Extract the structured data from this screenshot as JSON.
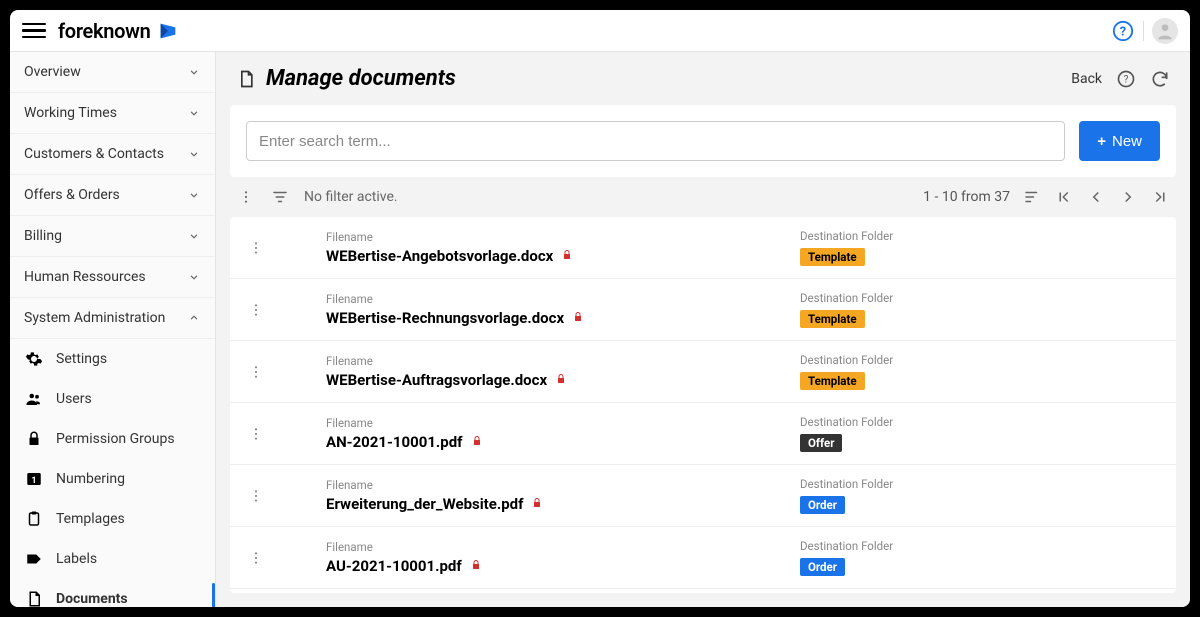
{
  "brand": "foreknown",
  "sidebar": {
    "groups": [
      {
        "label": "Overview",
        "expanded": false
      },
      {
        "label": "Working Times",
        "expanded": false
      },
      {
        "label": "Customers & Contacts",
        "expanded": false
      },
      {
        "label": "Offers & Orders",
        "expanded": false
      },
      {
        "label": "Billing",
        "expanded": false
      },
      {
        "label": "Human Ressources",
        "expanded": false
      },
      {
        "label": "System Administration",
        "expanded": true
      }
    ],
    "sysadmin_items": [
      {
        "icon": "gear",
        "label": "Settings"
      },
      {
        "icon": "users",
        "label": "Users"
      },
      {
        "icon": "lock",
        "label": "Permission Groups"
      },
      {
        "icon": "numbering",
        "label": "Numbering"
      },
      {
        "icon": "clipboard",
        "label": "Templages"
      },
      {
        "icon": "label",
        "label": "Labels"
      },
      {
        "icon": "document",
        "label": "Documents",
        "active": true
      }
    ]
  },
  "page": {
    "title": "Manage documents",
    "back": "Back",
    "search_placeholder": "Enter search term...",
    "new_button": "New",
    "filter_status": "No filter active.",
    "pagination": "1 - 10 from 37",
    "filename_label": "Filename",
    "folder_label": "Destination Folder"
  },
  "rows": [
    {
      "filename": "WEBertise-Angebotsvorlage.docx",
      "locked": true,
      "folder": "Template",
      "folder_class": "template"
    },
    {
      "filename": "WEBertise-Rechnungsvorlage.docx",
      "locked": true,
      "folder": "Template",
      "folder_class": "template"
    },
    {
      "filename": "WEBertise-Auftragsvorlage.docx",
      "locked": true,
      "folder": "Template",
      "folder_class": "template"
    },
    {
      "filename": "AN-2021-10001.pdf",
      "locked": true,
      "folder": "Offer",
      "folder_class": "offer"
    },
    {
      "filename": "Erweiterung_der_Website.pdf",
      "locked": true,
      "folder": "Order",
      "folder_class": "order"
    },
    {
      "filename": "AU-2021-10001.pdf",
      "locked": true,
      "folder": "Order",
      "folder_class": "order"
    }
  ]
}
